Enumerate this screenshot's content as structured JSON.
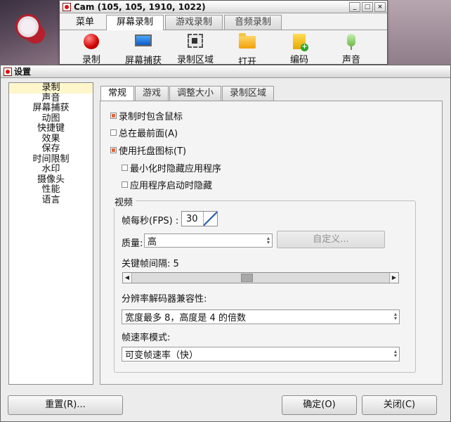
{
  "main_window": {
    "title": "Cam (105, 105, 1910, 1022)",
    "tabs": [
      {
        "label": "菜单"
      },
      {
        "label": "屏幕录制"
      },
      {
        "label": "游戏录制"
      },
      {
        "label": "音频录制"
      }
    ],
    "active_tab_index": 1,
    "toolbar": [
      {
        "label": "录制",
        "icon": "record-icon"
      },
      {
        "label": "屏幕捕获",
        "icon": "monitor-icon"
      },
      {
        "label": "录制区域",
        "icon": "region-icon"
      },
      {
        "label": "打开",
        "icon": "folder-icon"
      },
      {
        "label": "编码",
        "icon": "encode-icon"
      },
      {
        "label": "声音",
        "icon": "microphone-icon"
      }
    ]
  },
  "dialog": {
    "title": "设置",
    "categories": [
      "录制",
      "声音",
      "屏幕捕获",
      "动图",
      "快捷键",
      "效果",
      "保存",
      "时间限制",
      "水印",
      "摄像头",
      "性能",
      "语言"
    ],
    "selected_category_index": 0,
    "tabs": [
      "常规",
      "游戏",
      "调整大小",
      "录制区域"
    ],
    "active_tab_index": 0,
    "options": {
      "include_cursor": {
        "label": "录制时包含鼠标",
        "checked": true
      },
      "always_on_top": {
        "label": "总在最前面(A)",
        "checked": false
      },
      "tray_icon": {
        "label": "使用托盘图标(T)",
        "checked": true
      },
      "minimize_hide": {
        "label": "最小化时隐藏应用程序",
        "checked": false
      },
      "hide_on_start": {
        "label": "应用程序启动时隐藏",
        "checked": false
      }
    },
    "video": {
      "group_title": "视频",
      "fps_label": "帧每秒(FPS) :",
      "fps_value": "30",
      "quality_label": "质量:",
      "quality_value": "高",
      "custom_button": "自定义...",
      "keyframe_label": "关键帧间隔: 5",
      "keyframe_value": 5,
      "resolution_label": "分辨率解码器兼容性:",
      "resolution_value": "宽度最多 8，高度是 4 的倍数",
      "framerate_label": "帧速率模式:",
      "framerate_value": "可变帧速率（快）"
    },
    "buttons": {
      "reset": "重置(R)...",
      "ok": "确定(O)",
      "close": "关闭(C)"
    }
  },
  "colors": {
    "check_fill": "#e0663a",
    "selected_category_bg": "#fff6cc"
  }
}
